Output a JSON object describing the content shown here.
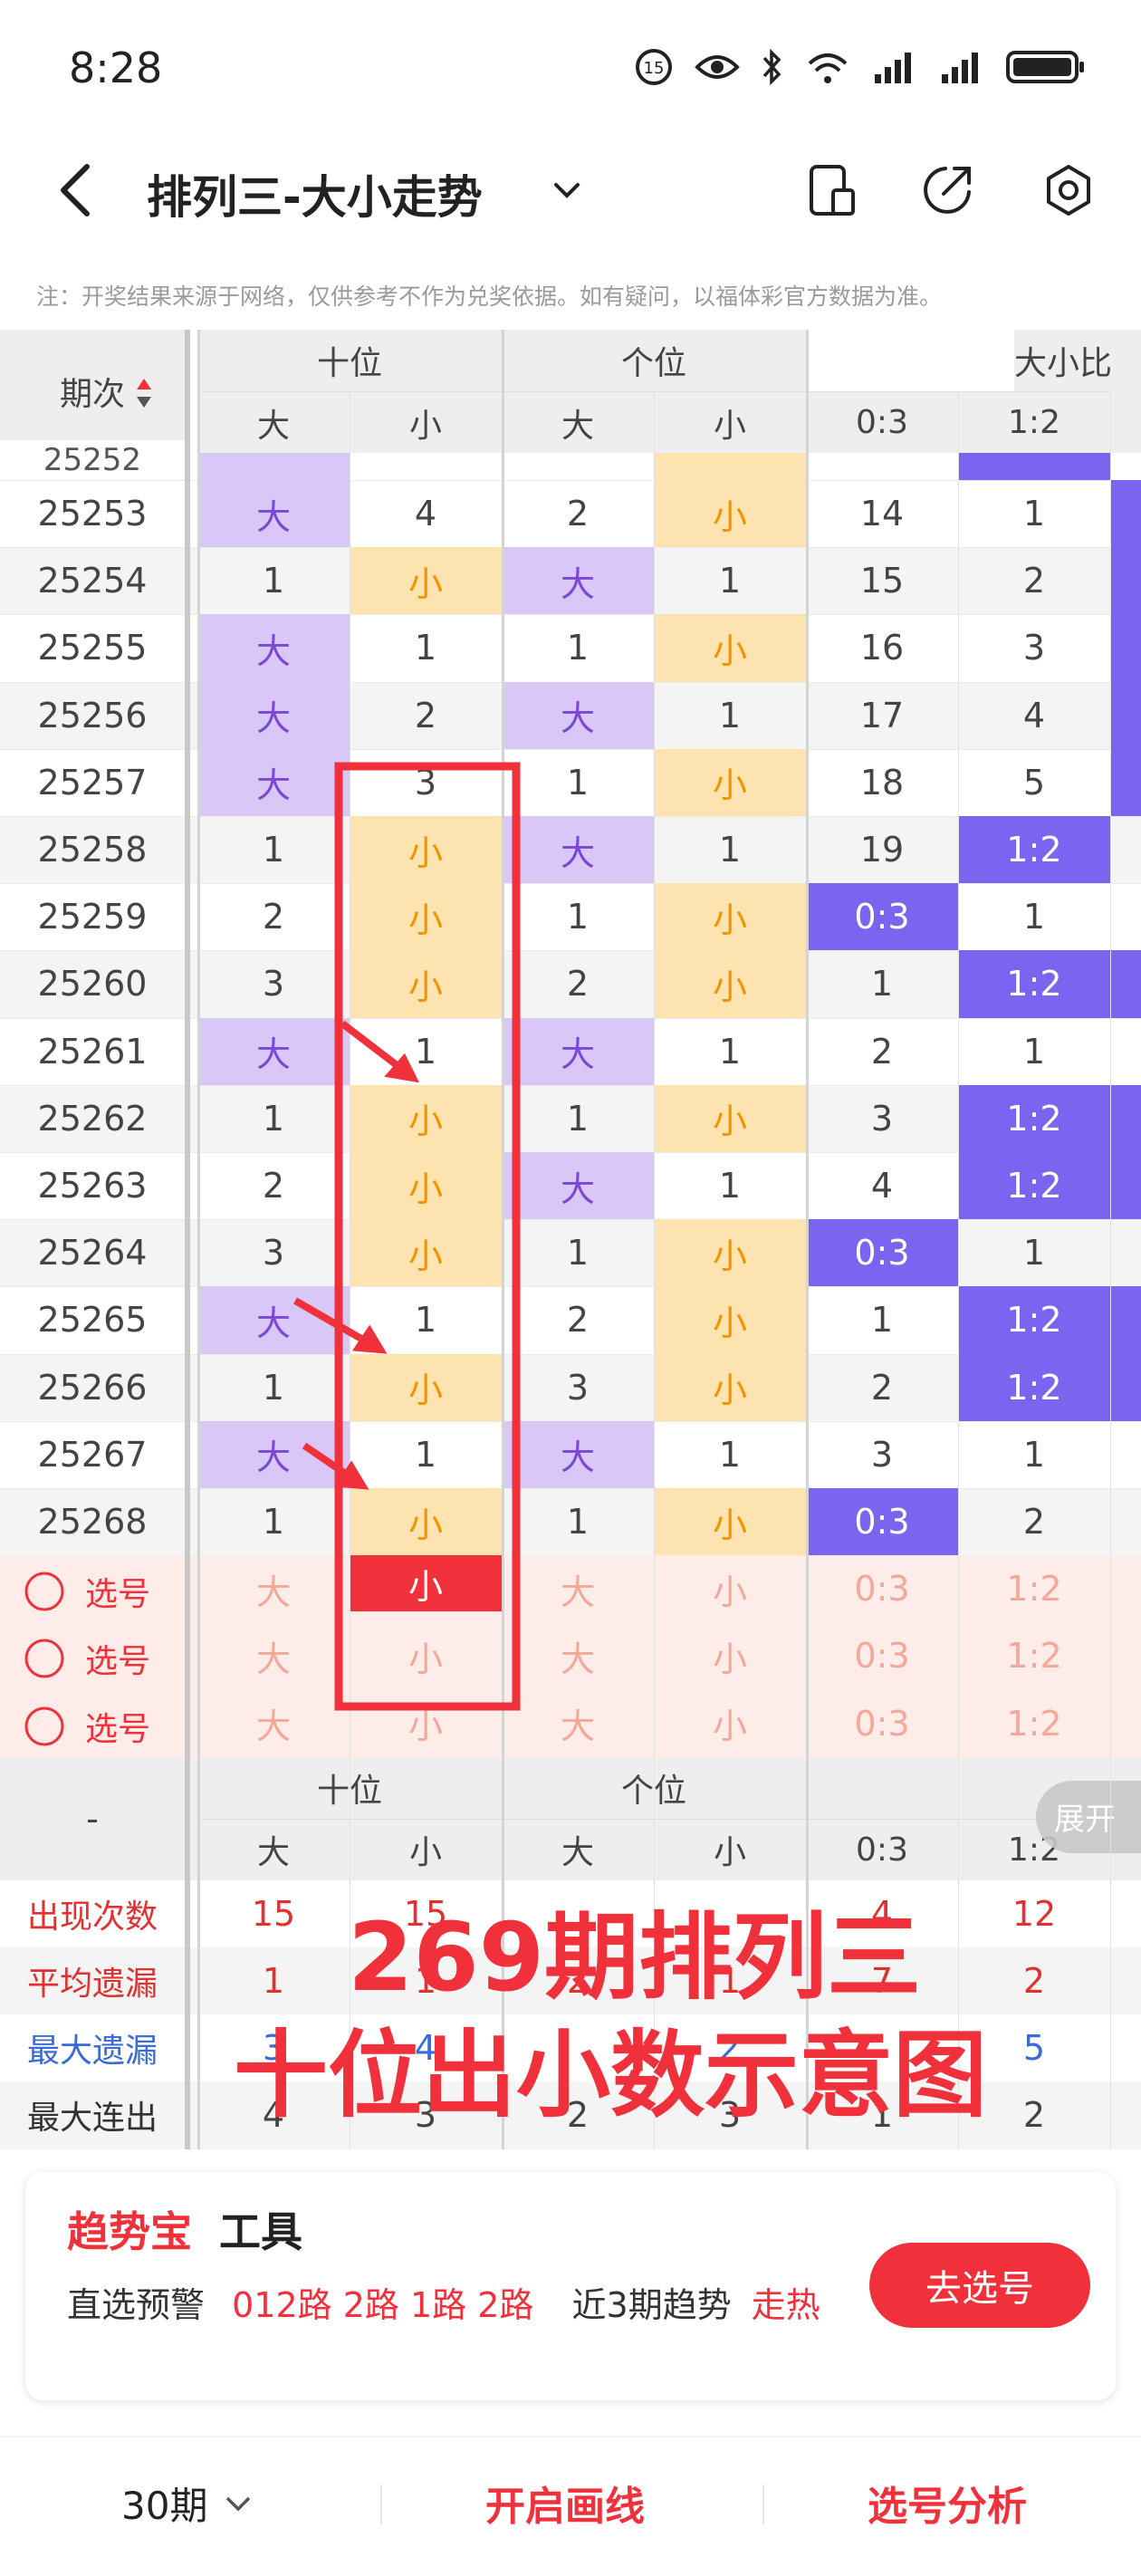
{
  "status_bar": {
    "time": "8:28"
  },
  "header": {
    "title": "排列三-大小走势"
  },
  "note": "注：开奖结果来源于网络，仅供参考不作为兑奖依据。如有疑问，以福体彩官方数据为准。",
  "table": {
    "col_period": "期次",
    "groups": [
      "十位",
      "个位",
      "大小比"
    ],
    "sub_headers": [
      "大",
      "小",
      "大",
      "小",
      "0:3",
      "1:2"
    ],
    "partial_row": "25252",
    "rows": [
      {
        "period": "25253",
        "v": [
          "大",
          "4",
          "2",
          "小",
          "14",
          "1"
        ]
      },
      {
        "period": "25254",
        "v": [
          "1",
          "小",
          "大",
          "1",
          "15",
          "2"
        ]
      },
      {
        "period": "25255",
        "v": [
          "大",
          "1",
          "1",
          "小",
          "16",
          "3"
        ]
      },
      {
        "period": "25256",
        "v": [
          "大",
          "2",
          "大",
          "1",
          "17",
          "4"
        ]
      },
      {
        "period": "25257",
        "v": [
          "大",
          "3",
          "1",
          "小",
          "18",
          "5"
        ]
      },
      {
        "period": "25258",
        "v": [
          "1",
          "小",
          "大",
          "1",
          "19",
          "1:2"
        ]
      },
      {
        "period": "25259",
        "v": [
          "2",
          "小",
          "1",
          "小",
          "0:3",
          "1"
        ]
      },
      {
        "period": "25260",
        "v": [
          "3",
          "小",
          "2",
          "小",
          "1",
          "1:2"
        ]
      },
      {
        "period": "25261",
        "v": [
          "大",
          "1",
          "大",
          "1",
          "2",
          "1"
        ]
      },
      {
        "period": "25262",
        "v": [
          "1",
          "小",
          "1",
          "小",
          "3",
          "1:2"
        ]
      },
      {
        "period": "25263",
        "v": [
          "2",
          "小",
          "大",
          "1",
          "4",
          "1:2"
        ]
      },
      {
        "period": "25264",
        "v": [
          "3",
          "小",
          "1",
          "小",
          "0:3",
          "1"
        ]
      },
      {
        "period": "25265",
        "v": [
          "大",
          "1",
          "2",
          "小",
          "1",
          "1:2"
        ]
      },
      {
        "period": "25266",
        "v": [
          "1",
          "小",
          "3",
          "小",
          "2",
          "1:2"
        ]
      },
      {
        "period": "25267",
        "v": [
          "大",
          "1",
          "大",
          "1",
          "3",
          "1"
        ]
      },
      {
        "period": "25268",
        "v": [
          "1",
          "小",
          "1",
          "小",
          "0:3",
          "2"
        ]
      }
    ],
    "select_label": "选号",
    "select_values": [
      "大",
      "小",
      "大",
      "小",
      "0:3",
      "1:2"
    ],
    "footer_groups": [
      "十位",
      "个位"
    ],
    "expand_label": "展开",
    "stats": [
      {
        "label": "出现次数",
        "v": [
          "15",
          "15",
          "",
          "",
          "4",
          "12"
        ]
      },
      {
        "label": "平均遗漏",
        "v": [
          "1",
          "1",
          "2",
          "1",
          "7",
          "2"
        ]
      },
      {
        "label": "最大遗漏",
        "v": [
          "3",
          "4",
          "",
          "2",
          "",
          "5"
        ]
      },
      {
        "label": "最大连出",
        "v": [
          "4",
          "3",
          "2",
          "3",
          "1",
          "2"
        ]
      }
    ],
    "footer_dash": "-"
  },
  "overlay": {
    "line1": "269期排列三",
    "line2": "十位出小数示意图"
  },
  "promo": {
    "brand": "趋势宝",
    "tool": "工具",
    "label1": "直选预警",
    "routes": "012路 2路 1路 2路",
    "label2": "近3期趋势",
    "trend": "走热",
    "button": "去选号"
  },
  "bottom_nav": {
    "periods": "30期",
    "draw": "开启画线",
    "analysis": "选号分析"
  },
  "colors": {
    "accent": "#f0303a",
    "purple": "#d9c8f7",
    "yellow": "#fde3b0",
    "blue": "#7b64f0"
  }
}
